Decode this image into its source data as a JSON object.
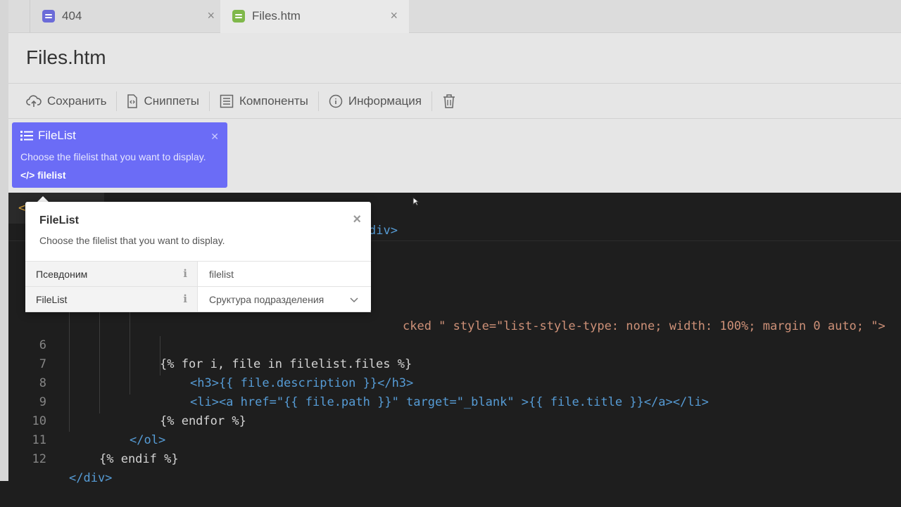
{
  "tabs": [
    {
      "label": "404",
      "icon": "document-icon",
      "active": false
    },
    {
      "label": "Files.htm",
      "icon": "document-icon",
      "active": true
    }
  ],
  "page": {
    "title": "Files.htm"
  },
  "toolbar": {
    "save_label": "Сохранить",
    "snippets_label": "Сниппеты",
    "components_label": "Компоненты",
    "info_label": "Информация"
  },
  "component_card": {
    "title": "FileList",
    "description": "Choose the filelist that you want to display.",
    "alias": "filelist"
  },
  "popover": {
    "title": "FileList",
    "description": "Choose the filelist that you want to display.",
    "properties": [
      {
        "name": "Псевдоним",
        "value": "filelist"
      },
      {
        "name": "FileList",
        "value": "Cруктура подразделения"
      }
    ]
  },
  "editor": {
    "tab_fragment": "<",
    "visible_tail_line2": "div>",
    "line5_tail": "cked \" style=\"list-style-type: none; width: 100%; margin 0 auto; \">",
    "lines": [
      {
        "n": "6",
        "code": "{% for i, file in filelist.files %}"
      },
      {
        "n": "7",
        "code": "<h3>{{ file.description }}</h3>"
      },
      {
        "n": "8",
        "code": "<li><a href=\"{{ file.path }}\" target=\"_blank\" >{{ file.title }}</a></li>"
      },
      {
        "n": "9",
        "code": "{% endfor %}"
      },
      {
        "n": "10",
        "code": "</ol>"
      },
      {
        "n": "11",
        "code": "{% endif %}"
      },
      {
        "n": "12",
        "code": "</div>"
      }
    ]
  },
  "colors": {
    "accent": "#6b6cf6",
    "editor_bg": "#1e1e1e",
    "tag": "#569cd6",
    "attr": "#9cdcfe",
    "string": "#ce9178"
  }
}
